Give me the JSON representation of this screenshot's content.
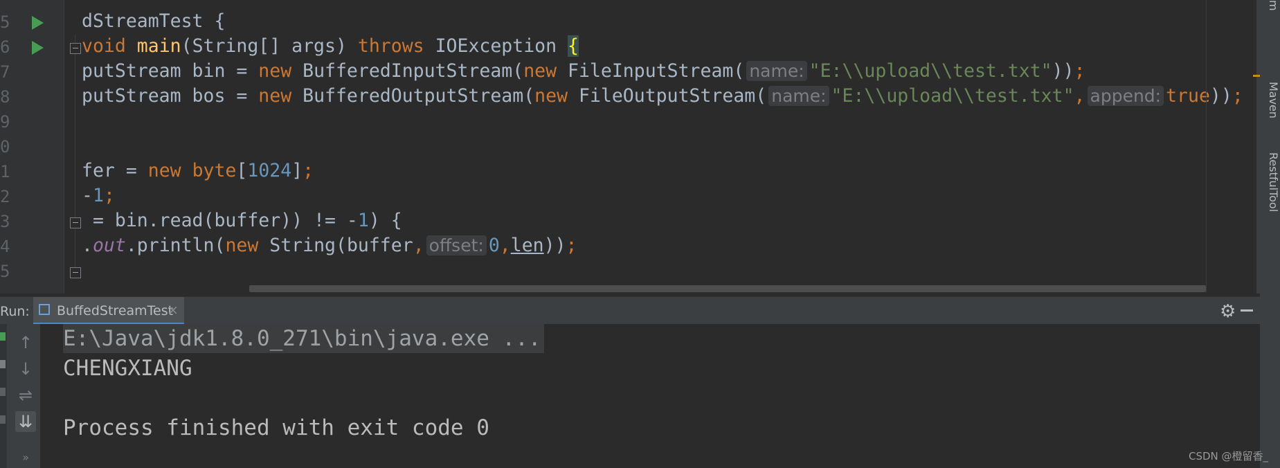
{
  "editor": {
    "line_numbers": [
      "5",
      "6",
      "7",
      "8",
      "9",
      "0",
      "1",
      "2",
      "3",
      "4",
      "5"
    ],
    "lines": [
      {
        "segments": [
          {
            "t": "dStreamTest {",
            "c": "plain"
          }
        ]
      },
      {
        "segments": [
          {
            "t": "void ",
            "c": "kw"
          },
          {
            "t": "main",
            "c": "fn"
          },
          {
            "t": "(String[] args) ",
            "c": "plain"
          },
          {
            "t": "throws ",
            "c": "kw"
          },
          {
            "t": "IOException ",
            "c": "plain"
          },
          {
            "t": "{",
            "c": "brace-hl"
          }
        ]
      },
      {
        "segments": [
          {
            "t": "putStream bin = ",
            "c": "plain"
          },
          {
            "t": "new ",
            "c": "kw"
          },
          {
            "t": "BufferedInputStream(",
            "c": "plain"
          },
          {
            "t": "new ",
            "c": "kw"
          },
          {
            "t": "FileInputStream(",
            "c": "plain"
          },
          {
            "t": "name:",
            "c": "hint"
          },
          {
            "t": "\"E:\\\\upload\\\\test.txt\"",
            "c": "str"
          },
          {
            "t": "))",
            "c": "plain"
          },
          {
            "t": ";",
            "c": "kw"
          }
        ]
      },
      {
        "segments": [
          {
            "t": "putStream bos = ",
            "c": "plain"
          },
          {
            "t": "new ",
            "c": "kw"
          },
          {
            "t": "BufferedOutputStream(",
            "c": "plain"
          },
          {
            "t": "new ",
            "c": "kw"
          },
          {
            "t": "FileOutputStream(",
            "c": "plain"
          },
          {
            "t": "name:",
            "c": "hint"
          },
          {
            "t": "\"E:\\\\upload\\\\test.txt\"",
            "c": "str"
          },
          {
            "t": ",",
            "c": "kw"
          },
          {
            "t": "append:",
            "c": "hint"
          },
          {
            "t": "true",
            "c": "kw"
          },
          {
            "t": "))",
            "c": "plain"
          },
          {
            "t": ";",
            "c": "kw"
          }
        ]
      },
      {
        "segments": []
      },
      {
        "segments": []
      },
      {
        "segments": [
          {
            "t": "fer = ",
            "c": "plain"
          },
          {
            "t": "new ",
            "c": "kw"
          },
          {
            "t": "byte",
            "c": "kw"
          },
          {
            "t": "[",
            "c": "plain"
          },
          {
            "t": "1024",
            "c": "num"
          },
          {
            "t": "]",
            "c": "plain"
          },
          {
            "t": ";",
            "c": "kw"
          }
        ]
      },
      {
        "segments": [
          {
            "t": "-",
            "c": "plain"
          },
          {
            "t": "1",
            "c": "num"
          },
          {
            "t": ";",
            "c": "kw"
          }
        ]
      },
      {
        "segments": [
          {
            "t": " = bin.read(buffer)) != -",
            "c": "plain"
          },
          {
            "t": "1",
            "c": "num"
          },
          {
            "t": ") {",
            "c": "plain"
          }
        ]
      },
      {
        "segments": [
          {
            "t": ".",
            "c": "plain"
          },
          {
            "t": "out",
            "c": "field"
          },
          {
            "t": ".println(",
            "c": "plain"
          },
          {
            "t": "new ",
            "c": "kw"
          },
          {
            "t": "String(buffer",
            "c": "plain"
          },
          {
            "t": ",",
            "c": "kw"
          },
          {
            "t": "offset:",
            "c": "hint"
          },
          {
            "t": "0",
            "c": "num"
          },
          {
            "t": ",",
            "c": "kw"
          },
          {
            "t": "len",
            "c": "ul"
          },
          {
            "t": "))",
            "c": "plain"
          },
          {
            "t": ";",
            "c": "kw"
          }
        ]
      },
      {
        "segments": []
      }
    ]
  },
  "side_panel": {
    "labels": [
      "m",
      "Maven",
      "RestfulTool"
    ]
  },
  "run_panel": {
    "label": "Run:",
    "tab_title": "BuffedStreamTest",
    "close_glyph": "×"
  },
  "console": {
    "lines": [
      "E:\\Java\\jdk1.8.0_271\\bin\\java.exe ...",
      "CHENGXIANG",
      "",
      "Process finished with exit code 0"
    ]
  },
  "watermark": "CSDN @橙留香_"
}
